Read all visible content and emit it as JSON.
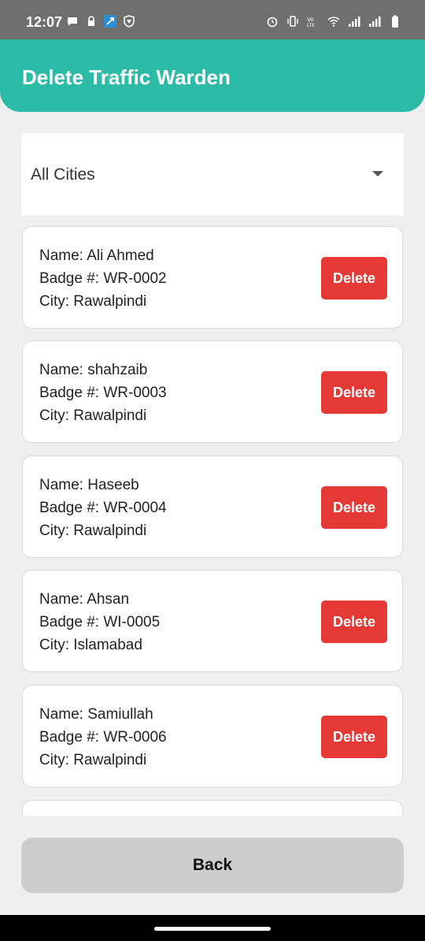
{
  "status_bar": {
    "time": "12:07"
  },
  "app_bar": {
    "title": "Delete Traffic Warden"
  },
  "city_filter": {
    "selected": "All Cities"
  },
  "wardens": [
    {
      "name": "Name: Ali Ahmed",
      "badge": "Badge #: WR-0002",
      "city": "City: Rawalpindi"
    },
    {
      "name": "Name: shahzaib",
      "badge": "Badge #: WR-0003",
      "city": "City: Rawalpindi"
    },
    {
      "name": "Name: Haseeb",
      "badge": "Badge #: WR-0004",
      "city": "City: Rawalpindi"
    },
    {
      "name": "Name: Ahsan",
      "badge": "Badge #: WI-0005",
      "city": "City: Islamabad"
    },
    {
      "name": "Name: Samiullah",
      "badge": "Badge #: WR-0006",
      "city": "City: Rawalpindi"
    }
  ],
  "delete_label": "Delete",
  "back_label": "Back",
  "colors": {
    "primary": "#2bbba7",
    "danger": "#e53935"
  }
}
